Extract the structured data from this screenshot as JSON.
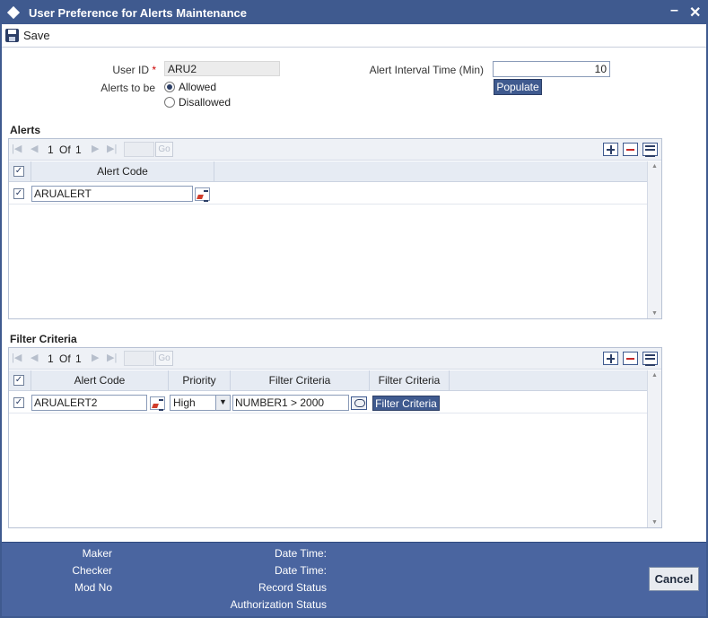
{
  "window": {
    "title": "User Preference for Alerts Maintenance",
    "minimize_glyph": "–",
    "close_glyph": "✕"
  },
  "toolbar": {
    "save_label": "Save",
    "save_icon": "floppy-disk-icon"
  },
  "form": {
    "user_id_label": "User ID",
    "required_mark": "*",
    "user_id_value": "ARU2",
    "alerts_to_be_label": "Alerts to be",
    "alerts_options": [
      "Allowed",
      "Disallowed"
    ],
    "alerts_selected": "Allowed",
    "interval_label": "Alert Interval Time (Min)",
    "interval_value": "10",
    "populate_label": "Populate"
  },
  "alerts": {
    "section_title": "Alerts",
    "pager": {
      "current": "1",
      "of_label": "Of",
      "total": "1",
      "go_label": "Go"
    },
    "columns": [
      "Alert Code"
    ],
    "rows": [
      {
        "checked": true,
        "alert_code": "ARUALERT"
      }
    ]
  },
  "filter": {
    "section_title": "Filter Criteria",
    "pager": {
      "current": "1",
      "of_label": "Of",
      "total": "1",
      "go_label": "Go"
    },
    "columns": [
      "Alert Code",
      "Priority",
      "Filter Criteria",
      "Filter Criteria"
    ],
    "rows": [
      {
        "checked": true,
        "alert_code": "ARUALERT2",
        "priority": "High",
        "filter_criteria": "NUMBER1 > 2000",
        "filter_button_label": "Filter Criteria"
      }
    ]
  },
  "footer": {
    "maker_label": "Maker",
    "checker_label": "Checker",
    "mod_no_label": "Mod No",
    "date_time_label": "Date Time:",
    "date_time_label_2": "Date Time:",
    "record_status_label": "Record Status",
    "authorization_status_label": "Authorization Status",
    "cancel_label": "Cancel"
  },
  "colors": {
    "titlebar": "#3f5a8f",
    "footer": "#4a65a0",
    "required": "#cc0000"
  }
}
